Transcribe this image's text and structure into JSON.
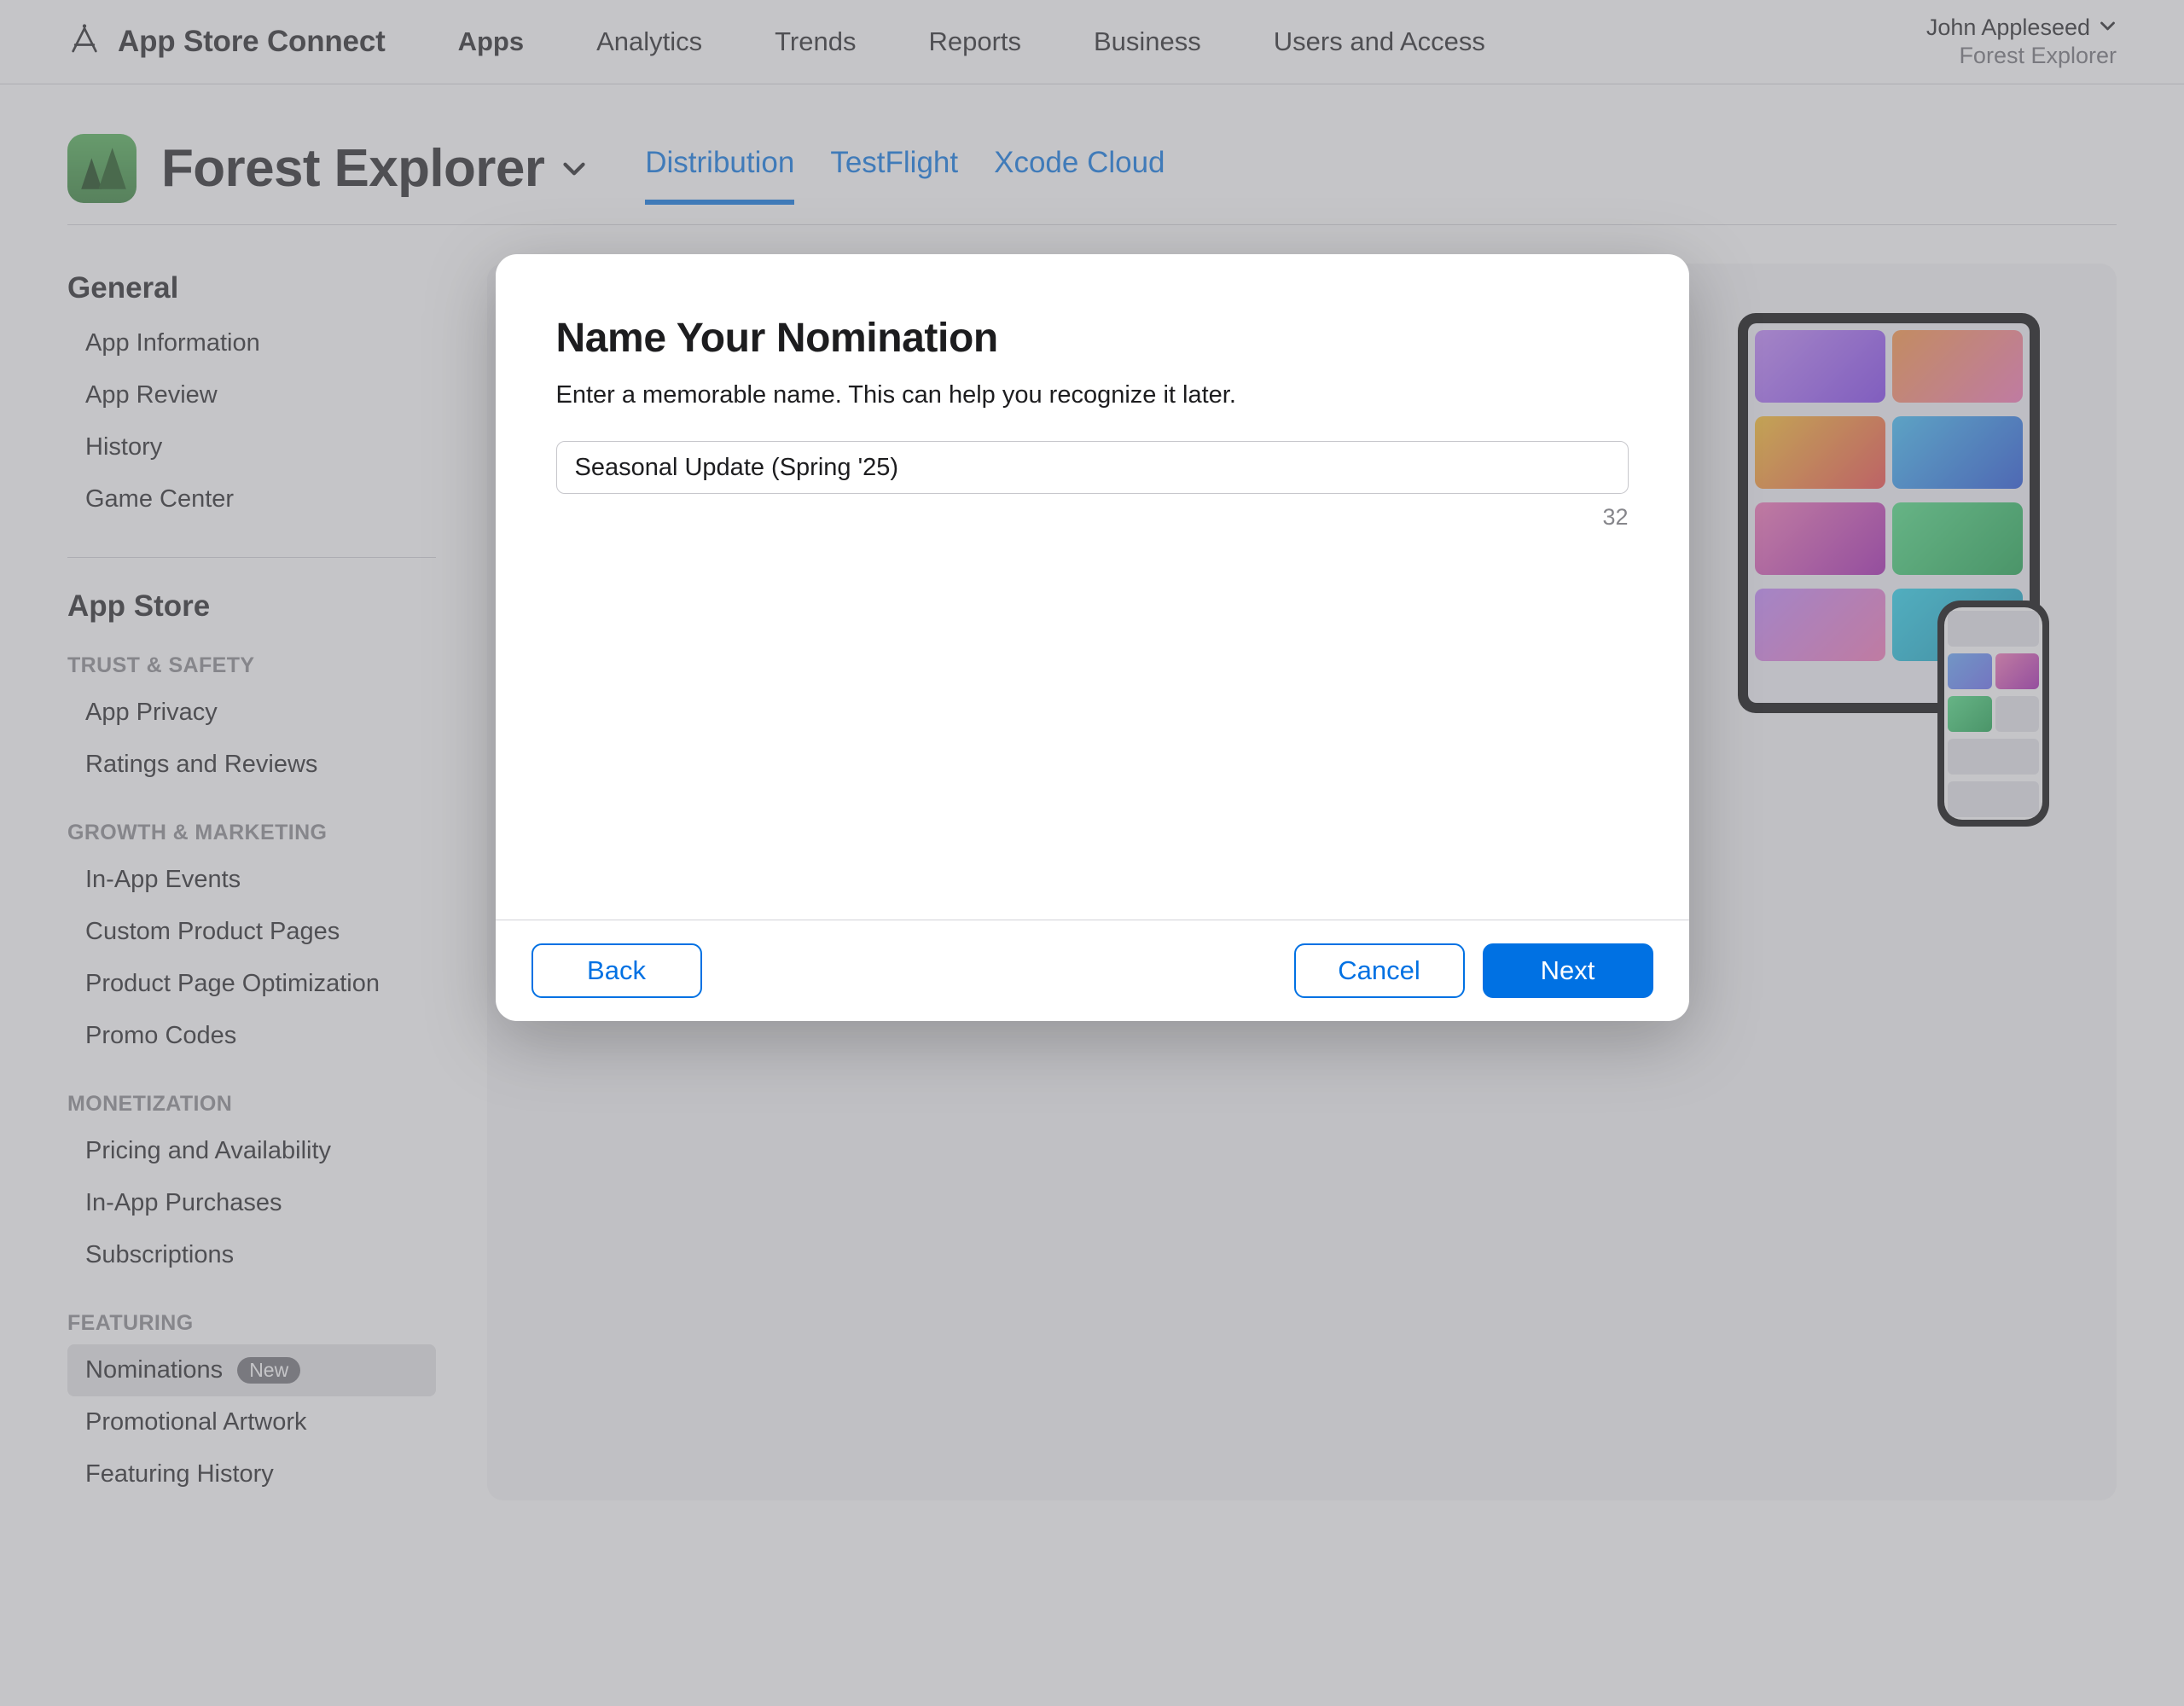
{
  "brand": {
    "name": "App Store Connect"
  },
  "nav": {
    "items": [
      "Apps",
      "Analytics",
      "Trends",
      "Reports",
      "Business",
      "Users and Access"
    ],
    "active_index": 0
  },
  "user": {
    "name": "John Appleseed",
    "context": "Forest Explorer"
  },
  "app": {
    "name": "Forest Explorer",
    "tabs": [
      "Distribution",
      "TestFlight",
      "Xcode Cloud"
    ],
    "active_tab_index": 0
  },
  "sidebar": {
    "sections": [
      {
        "heading": "General",
        "items": [
          {
            "label": "App Information"
          },
          {
            "label": "App Review"
          },
          {
            "label": "History"
          },
          {
            "label": "Game Center"
          }
        ]
      },
      {
        "heading": "App Store",
        "groups": [
          {
            "label": "TRUST & SAFETY",
            "items": [
              {
                "label": "App Privacy"
              },
              {
                "label": "Ratings and Reviews"
              }
            ]
          },
          {
            "label": "GROWTH & MARKETING",
            "items": [
              {
                "label": "In-App Events"
              },
              {
                "label": "Custom Product Pages"
              },
              {
                "label": "Product Page Optimization"
              },
              {
                "label": "Promo Codes"
              }
            ]
          },
          {
            "label": "MONETIZATION",
            "items": [
              {
                "label": "Pricing and Availability"
              },
              {
                "label": "In-App Purchases"
              },
              {
                "label": "Subscriptions"
              }
            ]
          },
          {
            "label": "FEATURING",
            "items": [
              {
                "label": "Nominations",
                "badge": "New",
                "selected": true
              },
              {
                "label": "Promotional Artwork"
              },
              {
                "label": "Featuring History"
              }
            ]
          }
        ]
      }
    ]
  },
  "modal": {
    "title": "Name Your Nomination",
    "description": "Enter a memorable name. This can help you recognize it later.",
    "input_value": "Seasonal Update (Spring '25)",
    "counter": "32",
    "back_label": "Back",
    "cancel_label": "Cancel",
    "next_label": "Next"
  }
}
